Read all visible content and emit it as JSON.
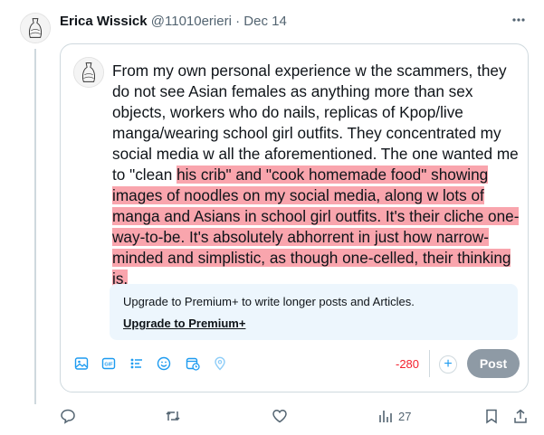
{
  "tweet": {
    "author_name": "Erica Wissick",
    "handle": "@11010erieri",
    "separator": "·",
    "date": "Dec 14",
    "more_icon": "more-horizontal-icon",
    "avatar_icon": "bottle-sketch-avatar"
  },
  "compose": {
    "text_plain": "From my own personal experience w the scammers, they do not see Asian females as anything more than sex objects, workers who do nails, replicas of Kpop/live manga/wearing school girl outfits. They concentrated my social media w all the aforementioned. The one wanted me to \"clean ",
    "text_highlight": "his crib\" and \"cook homemade food\" showing images of noodles on my social media, along w lots of manga and Asians in school girl outfits. It's their cliche one-way-to-be. It's absolutely abhorrent in just how narrow-minded and simplistic, as though one-celled, their thinking is.",
    "highlight_color": "#f9a5ad",
    "premium_text": "Upgrade to Premium+ to write longer posts and Articles.",
    "premium_link": "Upgrade to Premium+",
    "char_counter": "-280",
    "add_label": "+",
    "post_label": "Post",
    "toolbar_icons": [
      "image-icon",
      "gif-icon",
      "poll-icon",
      "emoji-icon",
      "schedule-icon",
      "location-icon"
    ]
  },
  "actions": {
    "reply_icon": "reply-icon",
    "retweet_icon": "retweet-icon",
    "like_icon": "like-icon",
    "views_icon": "views-icon",
    "views_count": "27",
    "bookmark_icon": "bookmark-icon",
    "share_icon": "share-icon"
  },
  "colors": {
    "accent": "#1d9bf0",
    "text": "#0f1419",
    "secondary": "#536471",
    "counter": "#f4212e",
    "post_button": "#8e9aa5",
    "premium_bg": "#edf6fd"
  }
}
